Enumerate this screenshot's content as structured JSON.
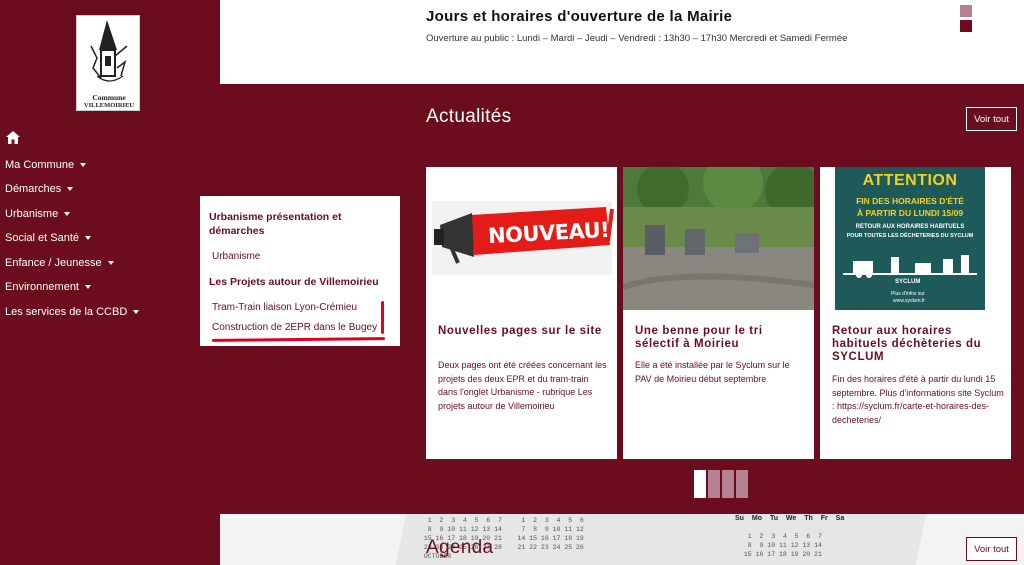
{
  "logo": {
    "line1": "Commune",
    "line2": "VILLEMOIRIEU"
  },
  "nav": {
    "items": [
      {
        "label": "Ma Commune"
      },
      {
        "label": "Démarches"
      },
      {
        "label": "Urbanisme"
      },
      {
        "label": "Social et Santé"
      },
      {
        "label": "Enfance / Jeunesse"
      },
      {
        "label": "Environnement"
      },
      {
        "label": "Les services de la CCBD"
      }
    ]
  },
  "submenu": {
    "heading1": "Urbanisme présentation et démarches",
    "link1": "Urbanisme",
    "heading2": "Les Projets autour de Villemoirieu",
    "link2": "Tram-Train liaison Lyon-Crémieu",
    "link3": "Construction de 2EPR dans le Bugey"
  },
  "hours": {
    "title": "Jours et horaires d'ouverture de la Mairie",
    "text": "Ouverture au public : Lundi – Mardi – Jeudi – Vendredi : 13h30 – 17h30 Mercredi et Samedi Fermée"
  },
  "news": {
    "title": "Actualités",
    "voir_tout": "Voir tout",
    "cards": [
      {
        "title": "Nouvelles pages sur le site",
        "text": "Deux pages ont été créées concernant les projets des deux EPR et du tram-train dans l'onglet Urbanisme - rubrique Les projets autour de Villemoirieu",
        "image_text": "NOUVEAU!"
      },
      {
        "title": "Une benne pour le tri sélectif à Moirieu",
        "text": "Elle a été installée par le Syclum sur le PAV de Moirieu début septembre"
      },
      {
        "title": "Retour aux horaires habituels déchèteries du SYCLUM",
        "text": "Fin des horaires d'été à partir du lundi 15 septembre. Plus d'informations site Syclum : https://syclum.fr/carte-et-horaires-des-decheteries/",
        "poster": {
          "l1": "ATTENTION",
          "l2": "FIN DES HORAIRES D'ÉTÉ",
          "l3": "À PARTIR DU LUNDI 15/09",
          "l4": "RETOUR AUX HORAIRES HABITUELS",
          "l5": "POUR TOUTES LES DÉCHETERIES DU SYCLUM",
          "brand": "SYCLUM",
          "info": "Plus d'infos sur",
          "url": "www.syclum.fr"
        }
      }
    ],
    "slides": 4,
    "active_slide": 1
  },
  "agenda": {
    "title": "Agenda",
    "voir_tout": "Voir tout",
    "cal_header": "Su Mo Tu We Th Fr Sa",
    "cal_grid": "  1  2  3  4  5  6  7     1  2  3  4  5  6\n  8  9 10 11 12 13 14     7  8  9 10 11 12\n 15 16 17 18 19 20 21    14 15 16 17 18 19\n 22 23 24 25 26 27 28    21 22 23 24 25 26\n OCTOBER",
    "cal_grid_right": "  1  2  3  4  5  6  7\n  8  9 10 11 12 13 14\n 15 16 17 18 19 20 21"
  },
  "colors": {
    "brand": "#6b0d1e",
    "brand_light": "#b48290",
    "annotation": "#e2001a"
  }
}
